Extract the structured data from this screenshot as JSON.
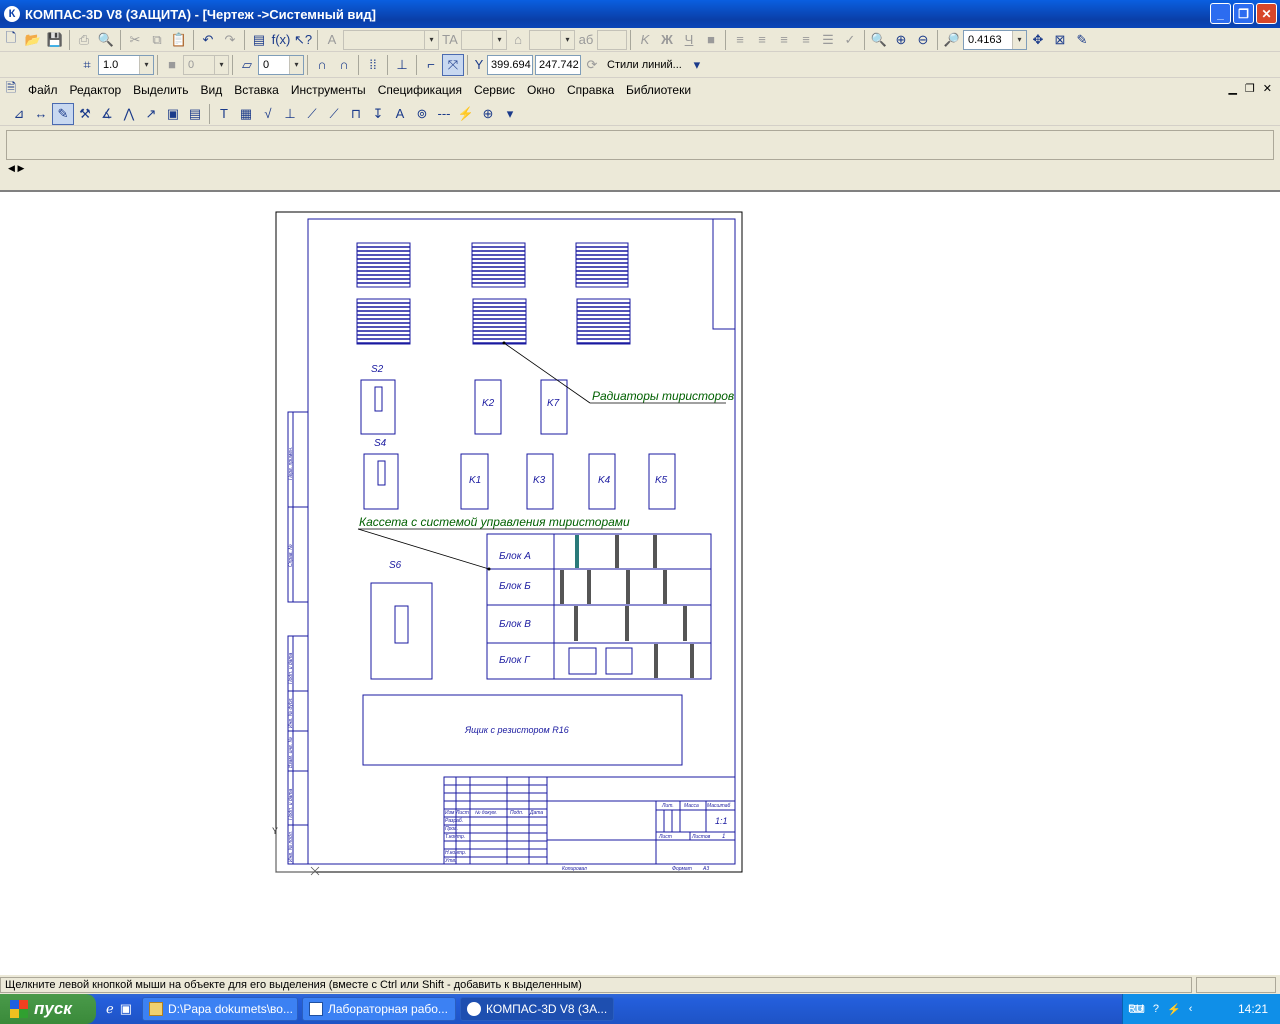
{
  "title": {
    "app": "КОМПАС-3D V8 (ЗАЩИТА) - [Чертеж ->Системный вид]",
    "logo_letter": "К"
  },
  "window_buttons": {
    "minimize": "_",
    "maximize": "❐",
    "close": "✕"
  },
  "toolbar_main": {
    "zoom_value": "0.4163",
    "font_size": "",
    "text_style": "",
    "line_count": ""
  },
  "toolbar_current": {
    "scale_value": "1.0",
    "layer_value": "0",
    "state_value": "0",
    "coord_x": "399.694",
    "coord_y": "247.742",
    "coord_y_label": "Y",
    "styles_label": "Стили линий...",
    "coord_x_label": "Y"
  },
  "menu": {
    "items": [
      {
        "label": "Файл"
      },
      {
        "label": "Редактор"
      },
      {
        "label": "Выделить"
      },
      {
        "label": "Вид"
      },
      {
        "label": "Вставка"
      },
      {
        "label": "Инструменты"
      },
      {
        "label": "Спецификация"
      },
      {
        "label": "Сервис"
      },
      {
        "label": "Окно"
      },
      {
        "label": "Справка"
      },
      {
        "label": "Библиотеки"
      }
    ]
  },
  "drawing": {
    "label_s2": "S2",
    "label_s4": "S4",
    "label_s6": "S6",
    "k2": "K2",
    "k7": "K7",
    "k1": "K1",
    "k3": "K3",
    "k4": "K4",
    "k5": "K5",
    "leader_radiators": "Радиаторы тиристоров",
    "leader_cassette": "Кассета с системой управления тиристорами",
    "block_a": "Блок А",
    "block_b": "Блок Б",
    "block_v": "Блок В",
    "block_g": "Блок Г",
    "resistor_box": "Ящик с резистором R16",
    "stamp": {
      "izm": "Изм",
      "list": "Лист",
      "ndoc": "№ докум.",
      "podp": "Подп.",
      "data": "Дата",
      "razrab": "Разраб.",
      "prov": "Пров.",
      "tkontr": "Т.контр.",
      "nkontr": "Н.контр.",
      "utv": "Утв.",
      "lit": "Лит.",
      "massa": "Масса",
      "masshtab": "Масштаб",
      "scale_value": "1:1",
      "list2": "Лист",
      "listov": "Листов",
      "listov_value": "1",
      "kopiroval": "Копировал",
      "format": "Формат",
      "format_value": "А3"
    },
    "side_stamp": {
      "inv_podl": "Инв. № подл.",
      "podp_data": "Подп. и дата",
      "vzam": "Взам. инв. №",
      "inv_dubl": "Инв. № дубл.",
      "podp_data2": "Подп. и дата",
      "sprav": "Справ. №",
      "perv": "Перв. примен."
    },
    "axis_y": "Y"
  },
  "status": {
    "text": "Щелкните левой кнопкой мыши на объекте для его выделения (вместе с Ctrl или Shift - добавить к выделенным)"
  },
  "taskbar": {
    "start_label": "пуск",
    "tasks": [
      {
        "label": "D:\\Papa dokumets\\во..."
      },
      {
        "label": "Лабораторная рабо..."
      },
      {
        "label": "КОМПАС-3D V8 (ЗА..."
      }
    ],
    "lang": "RU",
    "clock": "14:21"
  },
  "colors": {
    "drawing_blue": "#1a1aa0",
    "leader_green": "#006000",
    "taskbar_blue": "#245edb"
  }
}
